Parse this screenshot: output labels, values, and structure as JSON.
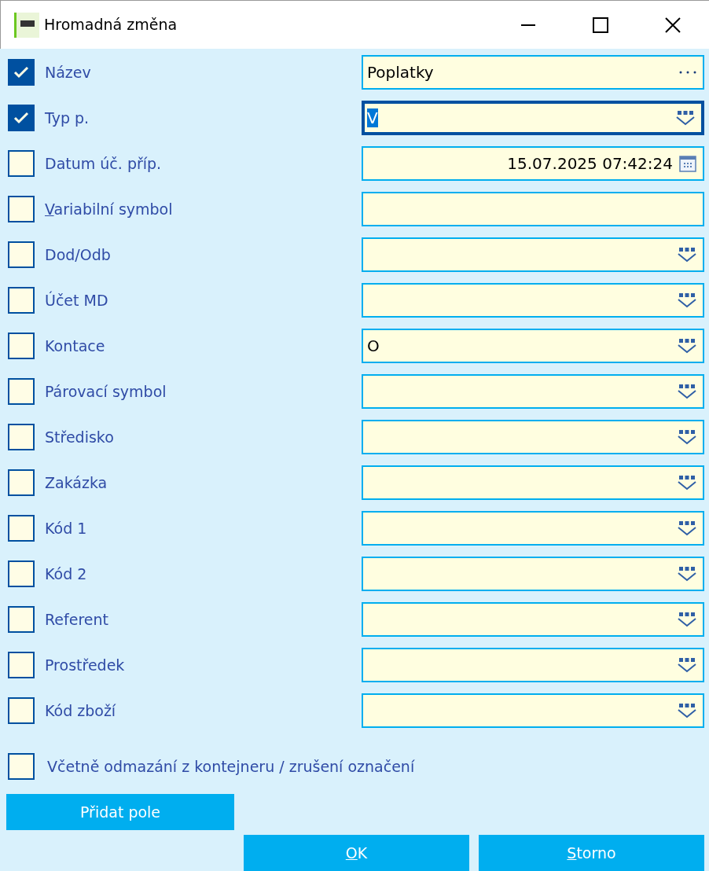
{
  "window": {
    "title": "Hromadná změna"
  },
  "fields": [
    {
      "label": "Název",
      "checked": true,
      "kind": "ellipsis",
      "value": "Poplatky",
      "focused": false
    },
    {
      "label": "Typ p.",
      "checked": true,
      "kind": "dropdown",
      "value": "V",
      "focused": true
    },
    {
      "label": "Datum úč. příp.",
      "checked": false,
      "kind": "date",
      "value": "15.07.2025 07:42:24",
      "focused": false
    },
    {
      "label": "Variabilní symbol",
      "checked": false,
      "kind": "plain",
      "underline_first": true,
      "focused": false
    },
    {
      "label": "Dod/Odb",
      "checked": false,
      "kind": "dropdown",
      "focused": false
    },
    {
      "label": "Účet MD",
      "checked": false,
      "kind": "dropdown",
      "focused": false
    },
    {
      "label": "Kontace",
      "checked": false,
      "kind": "dropdown",
      "value": "O",
      "focused": false
    },
    {
      "label": "Párovací symbol",
      "checked": false,
      "kind": "dropdown",
      "focused": false
    },
    {
      "label": "Středisko",
      "checked": false,
      "kind": "dropdown",
      "focused": false
    },
    {
      "label": "Zakázka",
      "checked": false,
      "kind": "dropdown",
      "focused": false
    },
    {
      "label": "Kód 1",
      "checked": false,
      "kind": "dropdown",
      "focused": false
    },
    {
      "label": "Kód 2",
      "checked": false,
      "kind": "dropdown",
      "focused": false
    },
    {
      "label": "Referent",
      "checked": false,
      "kind": "dropdown",
      "focused": false
    },
    {
      "label": "Prostředek",
      "checked": false,
      "kind": "dropdown",
      "focused": false
    },
    {
      "label": "Kód zboží",
      "checked": false,
      "kind": "dropdown",
      "focused": false
    }
  ],
  "include_option": {
    "label": "Včetně odmazání z kontejneru / zrušení označení",
    "checked": false
  },
  "add_button": "Přidat pole",
  "buttons": [
    {
      "label": "OK",
      "underline_first": true
    },
    {
      "label": "Storno",
      "underline_first": true
    }
  ]
}
